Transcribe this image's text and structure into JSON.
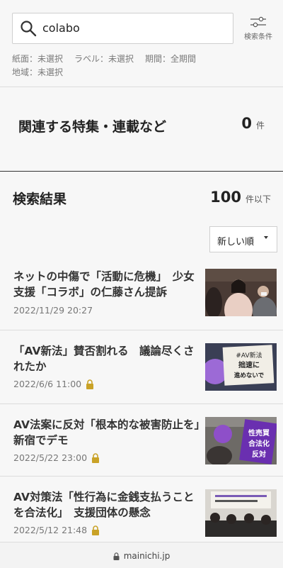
{
  "search": {
    "query": "colabo",
    "filter_label": "検索条件"
  },
  "conditions": {
    "paper": "紙面：未選択",
    "label": "ラベル：未選択",
    "period": "期間：全期間",
    "region": "地域：未選択"
  },
  "special": {
    "title": "関連する特集・連載など",
    "count": "0",
    "unit": "件"
  },
  "results": {
    "heading": "検索結果",
    "count": "100",
    "unit": "件以下"
  },
  "sort": {
    "selected": "新しい順"
  },
  "articles": [
    {
      "title": "ネットの中傷で「活動に危機」　少女支援「コラボ」の仁藤さん提訴",
      "date": "2022/11/29 20:27",
      "locked": false
    },
    {
      "title": "「AV新法」賛否割れる　議論尽くされたか",
      "date": "2022/6/6 11:00",
      "locked": true,
      "thumb_text": "#AV新法 拙速に 進めないで"
    },
    {
      "title": "AV法案に反対「根本的な被害防止を」　新宿でデモ",
      "date": "2022/5/22 23:00",
      "locked": true,
      "thumb_text": "性売買 合法化 反対"
    },
    {
      "title": "AV対策法「性行為に金銭支払うことを合法化」　支援団体の懸念",
      "date": "2022/5/12 21:48",
      "locked": true
    }
  ],
  "footer": {
    "domain": "mainichi.jp"
  },
  "colors": {
    "lock": "#c9a227",
    "background": "#f7f7f7"
  }
}
